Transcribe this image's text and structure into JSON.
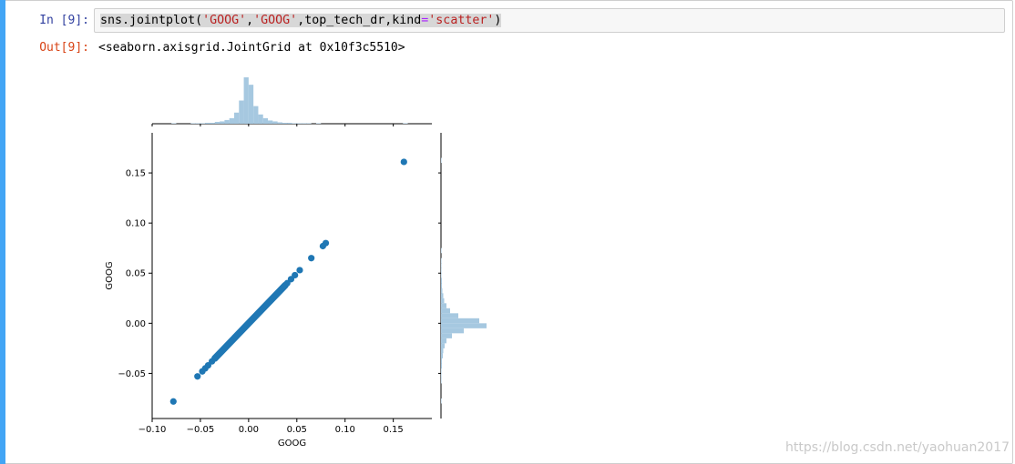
{
  "cell": {
    "in_prompt": "In [9]:",
    "out_prompt": "Out[9]:",
    "code": {
      "part1": "sns.jointplot(",
      "str1": "'GOOG'",
      "comma1": ",",
      "str2": "'GOOG'",
      "part2": ",top_tech_dr,kind",
      "eq": "=",
      "str3": "'scatter'",
      "part3": ")"
    },
    "output": "<seaborn.axisgrid.JointGrid at 0x10f3c5510>"
  },
  "watermark": "https://blog.csdn.net/yaohuan2017",
  "colors": {
    "active_bar": "#42a5f5",
    "scatter": "#1f77b4",
    "histogram": "#a6c8e0"
  },
  "chart_data": {
    "type": "scatter",
    "xlabel": "GOOG",
    "ylabel": "GOOG",
    "xlim": [
      -0.1,
      0.19
    ],
    "ylim": [
      -0.095,
      0.19
    ],
    "xticks": [
      -0.1,
      -0.05,
      0.0,
      0.05,
      0.1,
      0.15
    ],
    "xtick_labels": [
      "−0.10",
      "−0.05",
      "0.00",
      "0.05",
      "0.10",
      "0.15"
    ],
    "yticks": [
      -0.05,
      0.0,
      0.05,
      0.1,
      0.15
    ],
    "ytick_labels": [
      "−0.05",
      "0.00",
      "0.05",
      "0.10",
      "0.15"
    ],
    "grid": false,
    "points": [
      {
        "x": -0.078,
        "y": -0.078
      },
      {
        "x": -0.053,
        "y": -0.053
      },
      {
        "x": -0.048,
        "y": -0.048
      },
      {
        "x": -0.045,
        "y": -0.045
      },
      {
        "x": -0.042,
        "y": -0.042
      },
      {
        "x": -0.038,
        "y": -0.038
      },
      {
        "x": -0.035,
        "y": -0.035
      },
      {
        "x": 0.04,
        "y": 0.04
      },
      {
        "x": 0.044,
        "y": 0.044
      },
      {
        "x": 0.048,
        "y": 0.048
      },
      {
        "x": 0.053,
        "y": 0.053
      },
      {
        "x": 0.065,
        "y": 0.065
      },
      {
        "x": 0.077,
        "y": 0.077
      },
      {
        "x": 0.08,
        "y": 0.08
      },
      {
        "x": 0.161,
        "y": 0.161
      }
    ],
    "dense_range": [
      -0.035,
      0.038
    ],
    "histogram": {
      "bin_width": 0.005,
      "bins_start": -0.08,
      "counts": [
        1,
        0,
        0,
        0,
        1,
        1,
        1,
        2,
        2,
        4,
        5,
        8,
        12,
        24,
        50,
        100,
        84,
        38,
        20,
        12,
        7,
        5,
        3,
        2,
        2,
        1,
        1,
        1,
        1,
        0,
        1,
        0,
        0,
        0,
        0,
        0,
        0,
        0,
        0,
        0,
        0,
        0,
        0,
        0,
        0,
        0,
        0,
        0,
        1
      ]
    }
  }
}
